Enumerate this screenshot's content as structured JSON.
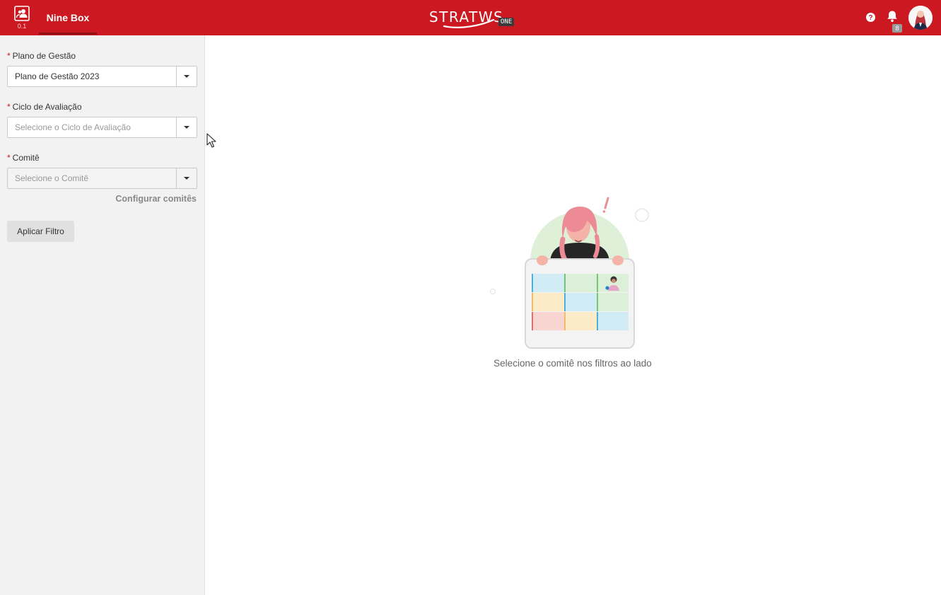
{
  "header": {
    "module_version": "0.1",
    "active_tab": "Nine Box",
    "brand_name": "STRATWS",
    "brand_suffix": "ONE",
    "notification_count": "8",
    "colors": {
      "topbar": "#cc1820",
      "tab_underline": "#8e0e14"
    }
  },
  "sidebar": {
    "fields": [
      {
        "label": "Plano de Gestão",
        "required": true,
        "value": "Plano de Gestão 2023",
        "placeholder": ""
      },
      {
        "label": "Ciclo de Avaliação",
        "required": true,
        "value": "",
        "placeholder": "Selecione o Ciclo de Avaliação"
      },
      {
        "label": "Comitê",
        "required": true,
        "value": "",
        "placeholder": "Selecione o Comitê"
      }
    ],
    "config_link": "Configurar comitês",
    "apply_button": "Aplicar Filtro"
  },
  "main": {
    "empty_state_message": "Selecione o comitê nos filtros ao lado",
    "illustration_icon": "nine-box-grid-illustration"
  }
}
